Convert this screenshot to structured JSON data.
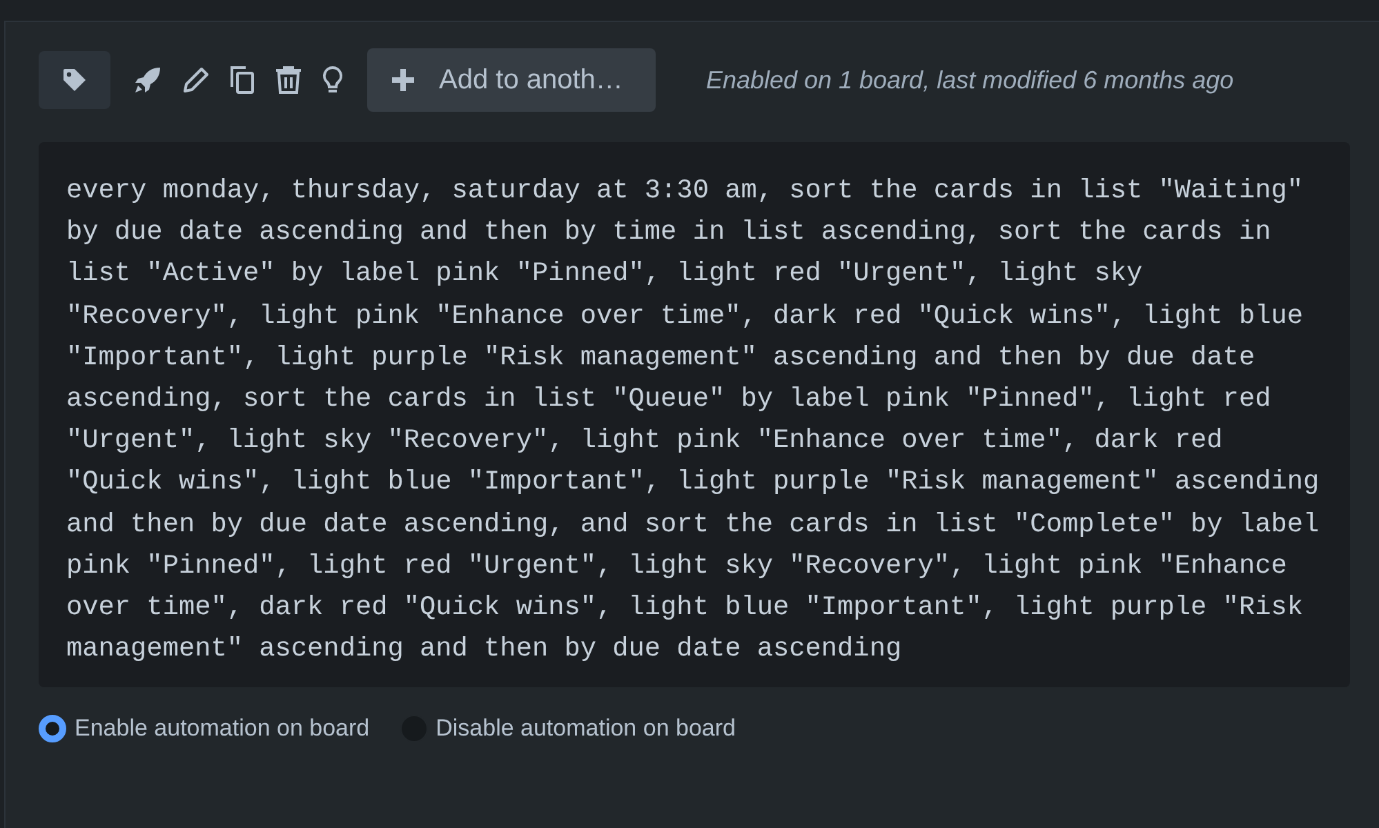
{
  "toolbar": {
    "add_button": "Add to anoth…",
    "status": "Enabled on 1 board, last modified 6 months ago"
  },
  "command": "every monday, thursday, saturday at 3:30 am, sort the cards in list \"Waiting\" by due date ascending and then by time in list ascending, sort the cards in list \"Active\" by label pink \"Pinned\", light red \"Urgent\", light sky \"Recovery\", light pink \"Enhance over time\", dark red \"Quick wins\", light blue \"Important\", light purple \"Risk management\" ascending and then by due date ascending, sort the cards in list \"Queue\" by label pink \"Pinned\", light red \"Urgent\", light sky \"Recovery\", light pink \"Enhance over time\", dark red \"Quick wins\", light blue \"Important\", light purple \"Risk management\" ascending and then by due date ascending, and sort the cards in list \"Complete\" by label pink \"Pinned\", light red \"Urgent\", light sky \"Recovery\", light pink \"Enhance over time\", dark red \"Quick wins\", light blue \"Important\", light purple \"Risk management\" ascending and then by due date ascending",
  "options": [
    {
      "label": "Enable automation on board",
      "selected": true
    },
    {
      "label": "Disable automation on board",
      "selected": false
    }
  ]
}
